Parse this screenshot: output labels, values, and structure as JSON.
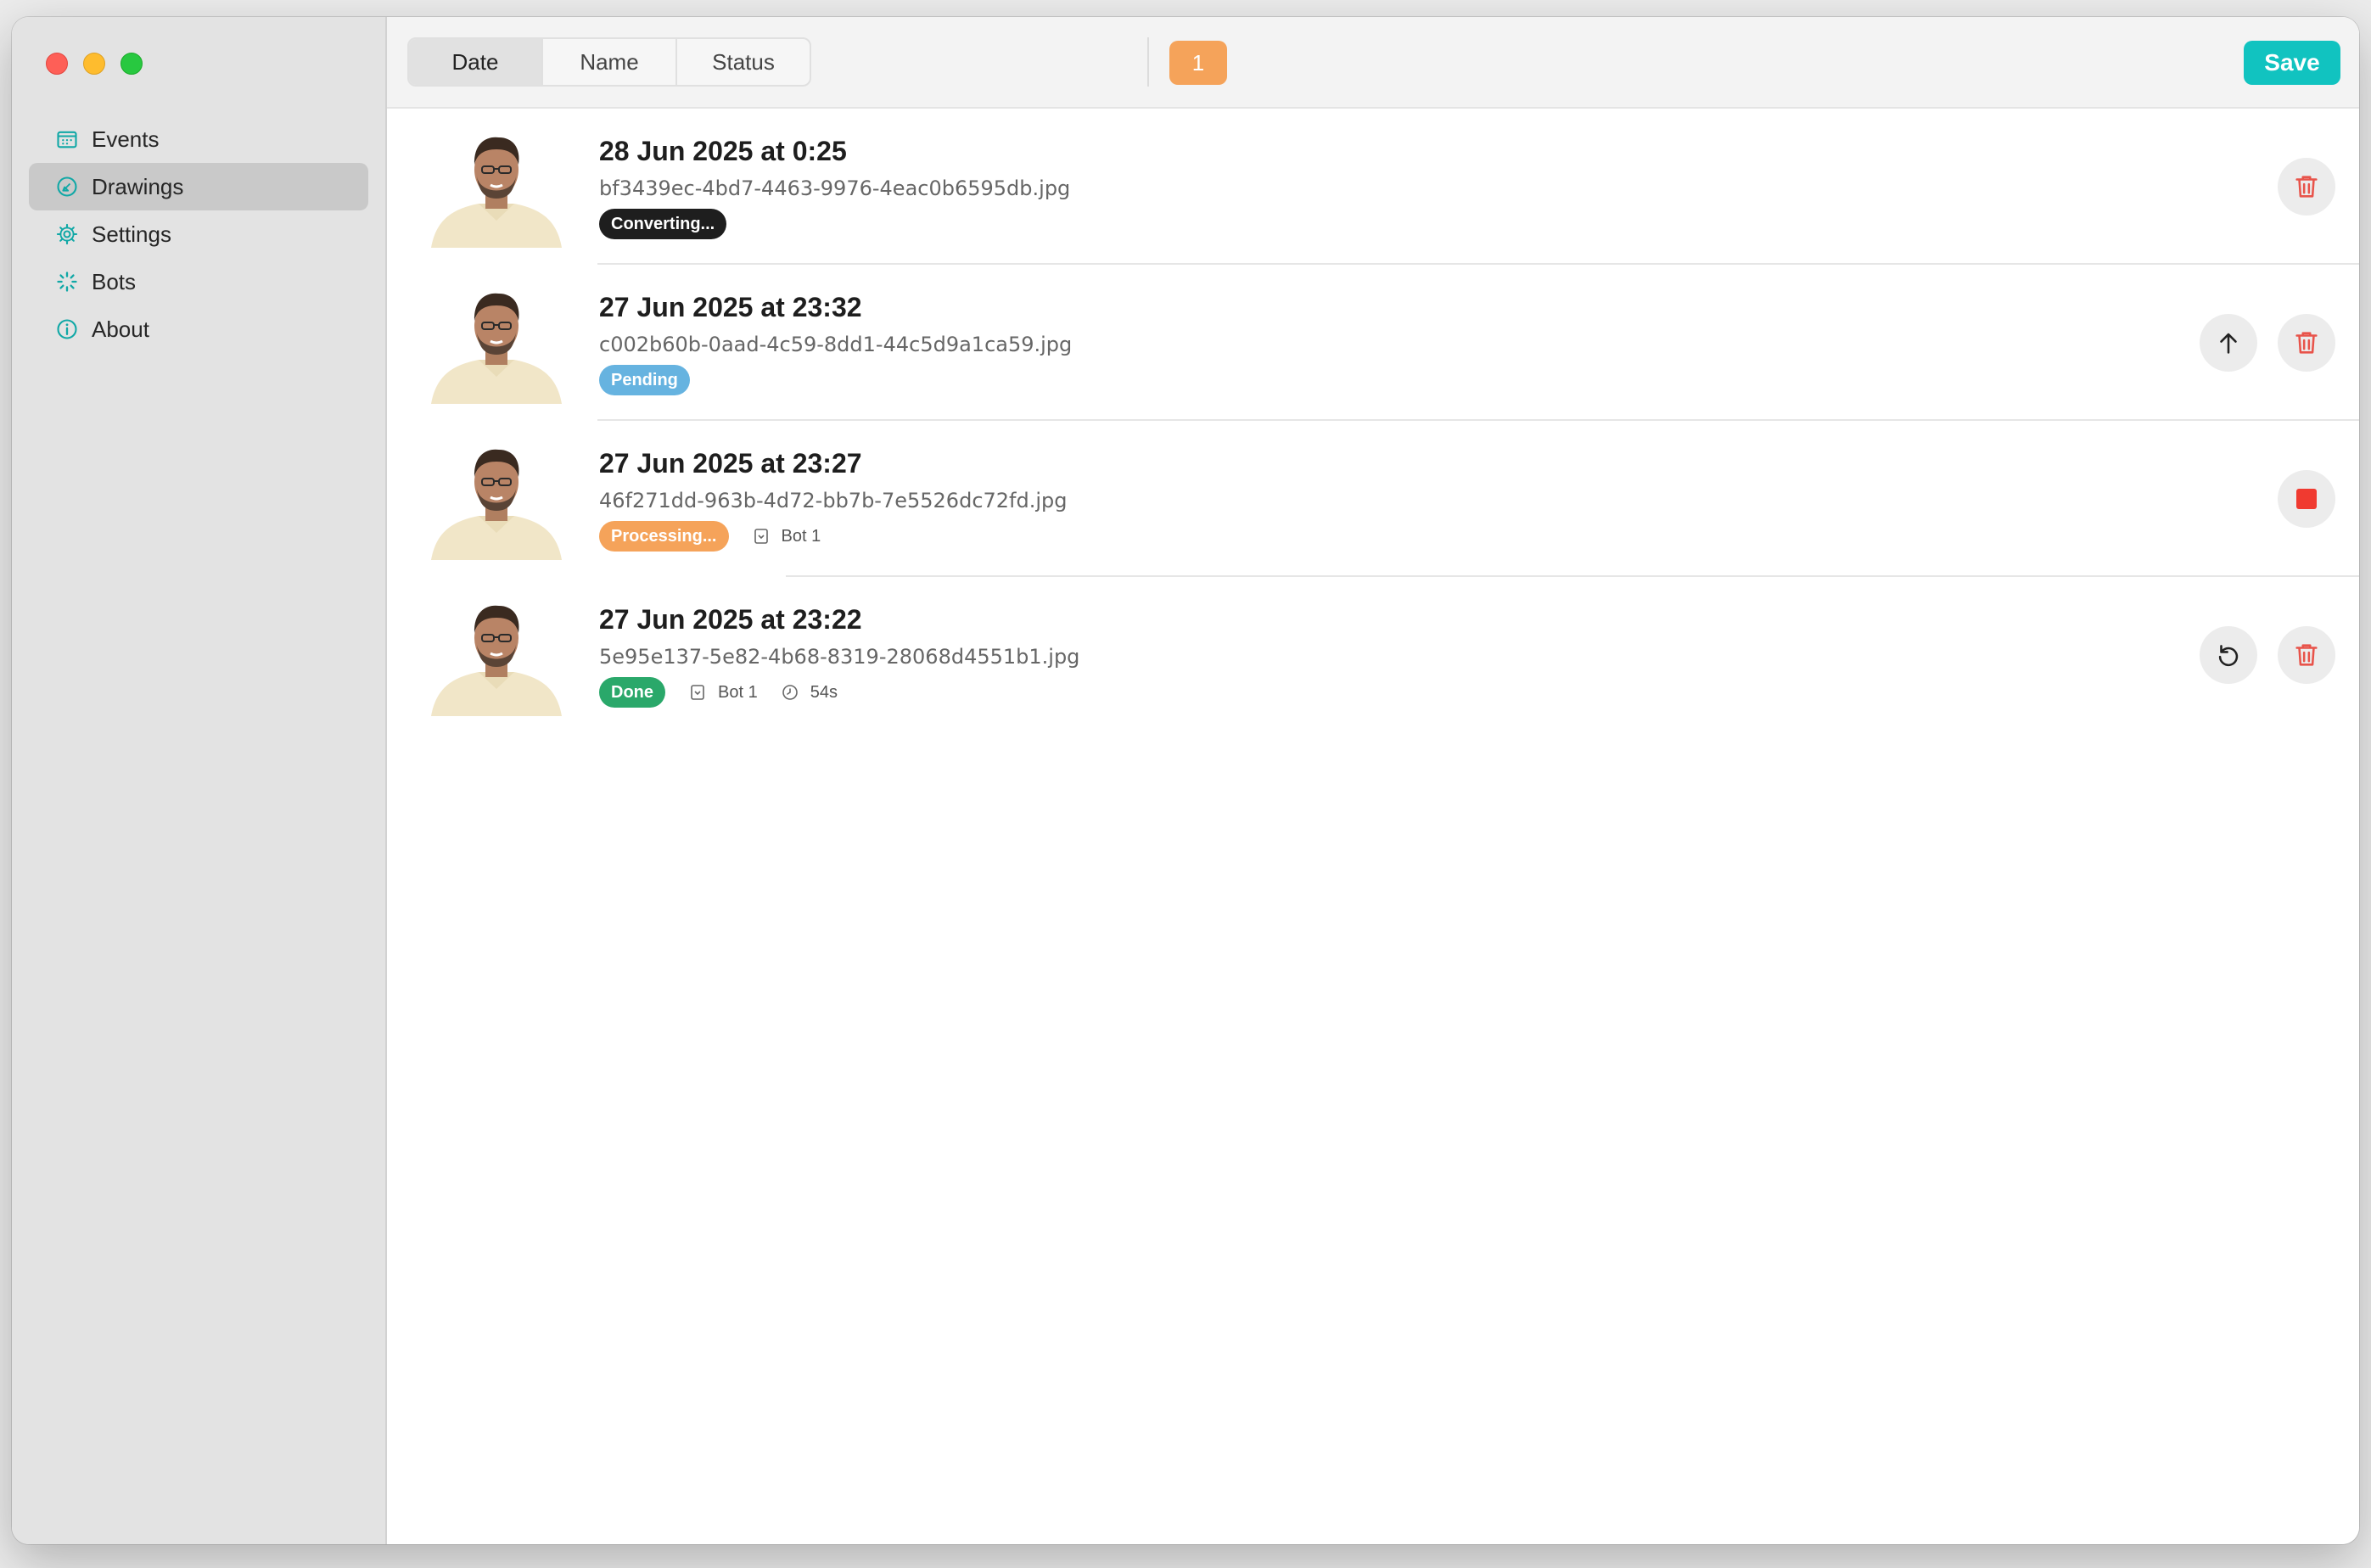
{
  "sidebar": {
    "items": [
      {
        "label": "Events",
        "icon": "calendar-icon",
        "active": false
      },
      {
        "label": "Drawings",
        "icon": "drawing-icon",
        "active": true
      },
      {
        "label": "Settings",
        "icon": "gear-icon",
        "active": false
      },
      {
        "label": "Bots",
        "icon": "spinner-icon",
        "active": false
      },
      {
        "label": "About",
        "icon": "info-icon",
        "active": false
      }
    ]
  },
  "toolbar": {
    "sort_tabs": [
      {
        "label": "Date",
        "active": true
      },
      {
        "label": "Name",
        "active": false
      },
      {
        "label": "Status",
        "active": false
      }
    ],
    "count": "1",
    "save_label": "Save"
  },
  "colors": {
    "accent": "#11c3c0",
    "orange": "#f5a35a",
    "delete_red": "#e8534a",
    "done_green": "#2aa86a",
    "pending_blue": "#66b3e0"
  },
  "drawings": [
    {
      "title": "28 Jun 2025 at 0:25",
      "filename": "bf3439ec-4bd7-4463-9976-4eac0b6595db.jpg",
      "status": "Converting...",
      "actions": [
        "delete"
      ]
    },
    {
      "title": "27 Jun 2025 at 23:32",
      "filename": "c002b60b-0aad-4c59-8dd1-44c5d9a1ca59.jpg",
      "status": "Pending",
      "actions": [
        "upload",
        "delete"
      ]
    },
    {
      "title": "27 Jun 2025 at 23:27",
      "filename": "46f271dd-963b-4d72-bb7b-7e5526dc72fd.jpg",
      "status": "Processing...",
      "bot": "Bot 1",
      "actions": [
        "stop"
      ]
    },
    {
      "title": "27 Jun 2025 at 23:22",
      "filename": "5e95e137-5e82-4b68-8319-28068d4551b1.jpg",
      "status": "Done",
      "bot": "Bot 1",
      "duration": "54s",
      "actions": [
        "retry",
        "delete"
      ]
    }
  ]
}
